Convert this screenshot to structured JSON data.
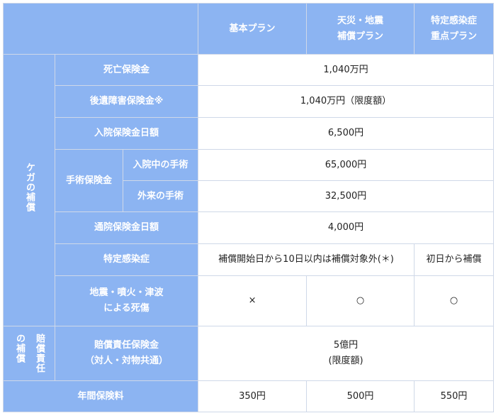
{
  "header": {
    "col_basic": "基本プラン",
    "col_disaster": [
      "天災・地震",
      "補償プラン"
    ],
    "col_infection": [
      "特定感染症",
      "重点プラン"
    ]
  },
  "injury_group": "ケガの補償",
  "liability_group": [
    "賠償責任",
    "の補償"
  ],
  "rows": {
    "death": {
      "label": "死亡保険金",
      "value": "1,040万円"
    },
    "disability": {
      "label": "後遺障害保険金※",
      "value": "1,040万円（限度額）"
    },
    "hospital_daily": {
      "label": "入院保険金日額",
      "value": "6,500円"
    },
    "surgery": {
      "label": "手術保険金",
      "inpatient_label": "入院中の手術",
      "inpatient_value": "65,000円",
      "outpatient_label": "外来の手術",
      "outpatient_value": "32,500円"
    },
    "outpatient_daily": {
      "label": "通院保険金日額",
      "value": "4,000円"
    },
    "infection": {
      "label": "特定感染症",
      "value_basic_disaster": "補償開始日から10日以内は補償対象外(＊)",
      "value_infection": "初日から補償"
    },
    "quake": {
      "label": [
        "地震・噴火・津波",
        "による死傷"
      ],
      "basic": "×",
      "disaster": "○",
      "infection": "○"
    },
    "liability": {
      "label": [
        "賠償責任保険金",
        "（対人・対物共通）"
      ],
      "value": [
        "5億円",
        "(限度額)"
      ]
    },
    "premium": {
      "label": "年間保険料",
      "basic": "350円",
      "disaster": "500円",
      "infection": "550円"
    }
  },
  "colors": {
    "header_blue": "#8cb4f2",
    "border": "#cfd8e8",
    "text": "#222222"
  }
}
